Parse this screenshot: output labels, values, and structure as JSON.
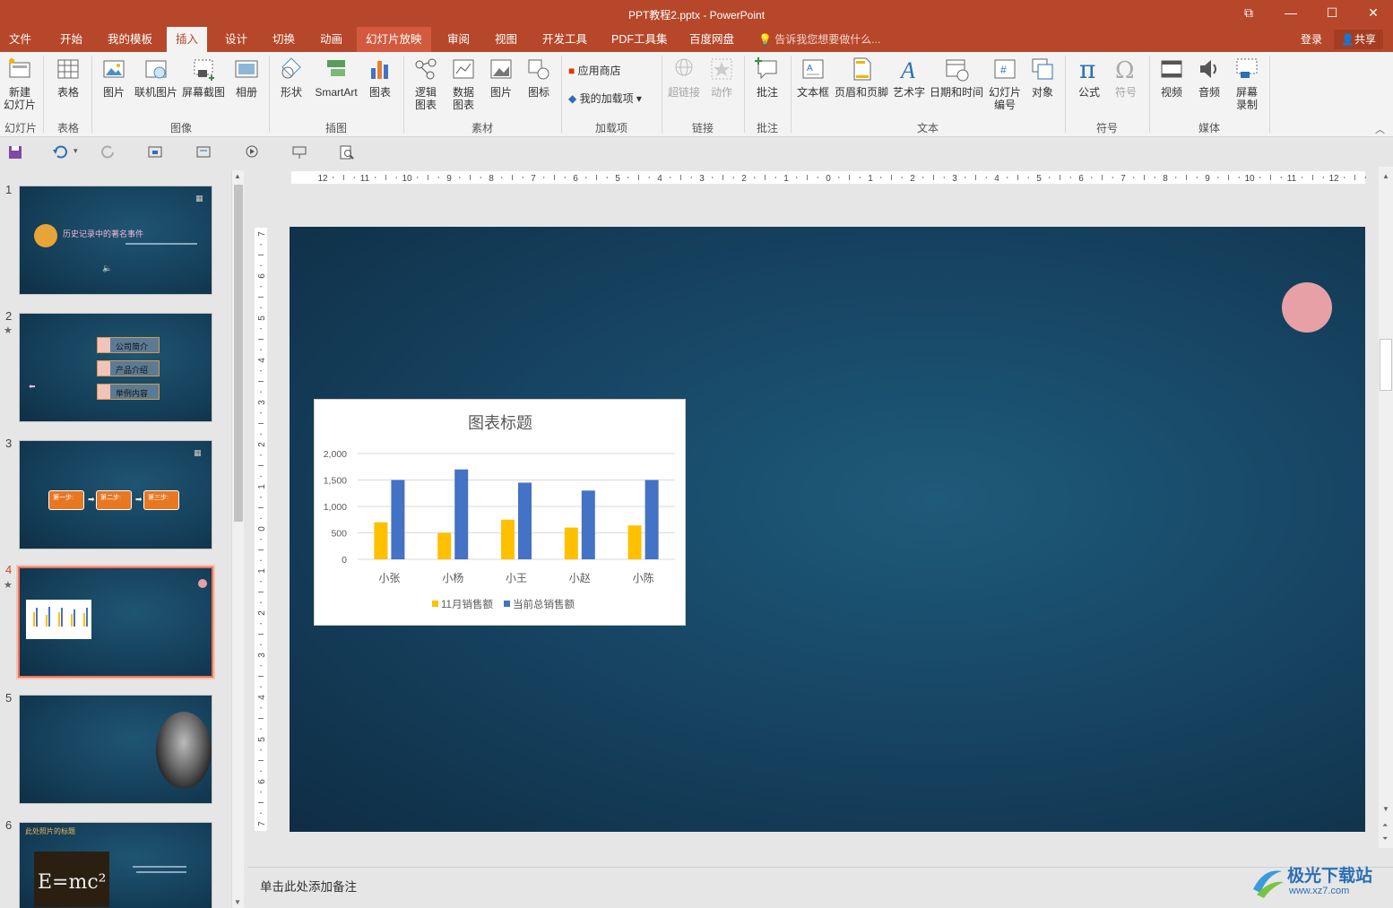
{
  "window": {
    "title": "PPT教程2.pptx - PowerPoint"
  },
  "menu": {
    "tabs": [
      "文件",
      "开始",
      "我的模板",
      "插入",
      "设计",
      "切换",
      "动画",
      "幻灯片放映",
      "审阅",
      "视图",
      "开发工具",
      "PDF工具集",
      "百度网盘"
    ],
    "active_tab": "插入",
    "tell_me": "告诉我您想要做什么...",
    "login": "登录",
    "share": "共享"
  },
  "ribbon": {
    "new_slide": "新建\n幻灯片",
    "table": "表格",
    "picture": "图片",
    "online_picture": "联机图片",
    "screenshot": "屏幕截图",
    "album": "相册",
    "shapes": "形状",
    "smartart": "SmartArt",
    "chart": "图表",
    "logic_chart": "逻辑\n图表",
    "data_chart": "数据\n图表",
    "material_picture": "图片",
    "icon": "图标",
    "app_store": "应用商店",
    "my_addins": "我的加载项",
    "hyperlink": "超链接",
    "action": "动作",
    "comment": "批注",
    "textbox": "文本框",
    "header_footer": "页眉和页脚",
    "wordart": "艺术字",
    "date_time": "日期和时间",
    "slide_number": "幻灯片\n编号",
    "object": "对象",
    "equation": "公式",
    "symbol": "符号",
    "video": "视频",
    "audio": "音频",
    "screen_record": "屏幕\n录制",
    "groups": {
      "slides": "幻灯片",
      "tables": "表格",
      "images": "图像",
      "illustrations": "插图",
      "material": "素材",
      "addins": "加载项",
      "links": "链接",
      "comments": "批注",
      "text": "文本",
      "symbols": "符号",
      "media": "媒体"
    }
  },
  "hruler_ticks": [
    "12",
    "11",
    "10",
    "9",
    "8",
    "7",
    "6",
    "5",
    "4",
    "3",
    "2",
    "1",
    "0",
    "1",
    "2",
    "3",
    "4",
    "5",
    "6",
    "7",
    "8",
    "9",
    "10",
    "11",
    "12"
  ],
  "vruler_ticks": [
    "7",
    "6",
    "5",
    "4",
    "3",
    "2",
    "1",
    "0",
    "1",
    "2",
    "3",
    "4",
    "5",
    "6",
    "7"
  ],
  "thumbnails": {
    "numbers": [
      "1",
      "2",
      "3",
      "4",
      "5",
      "6"
    ],
    "slide1_title": "历史记录中的著名事件",
    "slide2_items": [
      "公司简介",
      "产品介绍",
      "举例内容"
    ],
    "slide3_steps": [
      "第一步:",
      "第二步:",
      "第三步:"
    ],
    "slide6_title": "此处照片的标题",
    "slide6_formula": "E=mc²"
  },
  "chart_data": {
    "type": "bar",
    "title": "图表标题",
    "categories": [
      "小张",
      "小杨",
      "小王",
      "小赵",
      "小陈"
    ],
    "series": [
      {
        "name": "11月销售额",
        "color": "#ffc000",
        "values": [
          700,
          500,
          750,
          600,
          640
        ]
      },
      {
        "name": "当前总销售额",
        "color": "#4472c4",
        "values": [
          1500,
          1700,
          1450,
          1300,
          1500
        ]
      }
    ],
    "yticks": [
      "0",
      "500",
      "1,000",
      "1,500",
      "2,000"
    ],
    "ylim": [
      0,
      2000
    ],
    "grid": true,
    "legend_position": "bottom"
  },
  "notes": {
    "placeholder": "单击此处添加备注"
  },
  "watermark": {
    "brand": "极光下载站",
    "url": "www.xz7.com"
  }
}
